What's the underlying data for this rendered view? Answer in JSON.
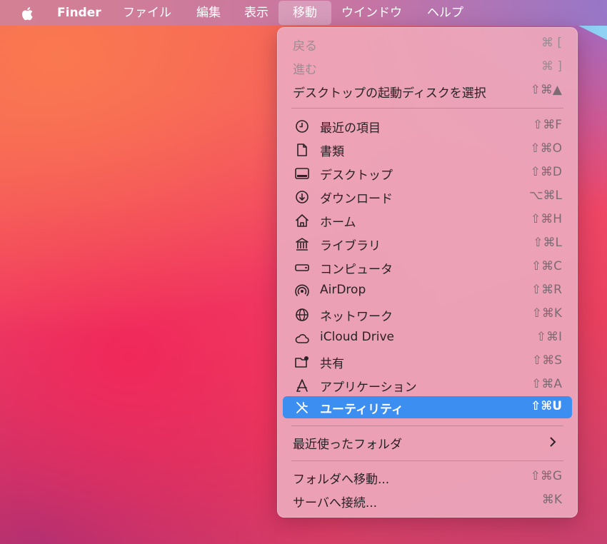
{
  "menubar": {
    "app": "Finder",
    "items": [
      "ファイル",
      "編集",
      "表示",
      "移動",
      "ウインドウ",
      "ヘルプ"
    ]
  },
  "go_menu": {
    "back": {
      "label": "戻る",
      "shortcut": "⌘ ["
    },
    "forward": {
      "label": "進む",
      "shortcut": "⌘ ]"
    },
    "startup_disk": {
      "label": "デスクトップの起動ディスクを選択",
      "shortcut": "⇧⌘▲"
    },
    "places": [
      {
        "label": "最近の項目",
        "shortcut": "⇧⌘F",
        "icon": "clock-icon"
      },
      {
        "label": "書類",
        "shortcut": "⇧⌘O",
        "icon": "document-icon"
      },
      {
        "label": "デスクトップ",
        "shortcut": "⇧⌘D",
        "icon": "desktop-icon"
      },
      {
        "label": "ダウンロード",
        "shortcut": "⌥⌘L",
        "icon": "download-icon"
      },
      {
        "label": "ホーム",
        "shortcut": "⇧⌘H",
        "icon": "home-icon"
      },
      {
        "label": "ライブラリ",
        "shortcut": "⇧⌘L",
        "icon": "library-icon"
      },
      {
        "label": "コンピュータ",
        "shortcut": "⇧⌘C",
        "icon": "computer-icon"
      },
      {
        "label": "AirDrop",
        "shortcut": "⇧⌘R",
        "icon": "airdrop-icon"
      },
      {
        "label": "ネットワーク",
        "shortcut": "⇧⌘K",
        "icon": "network-icon"
      },
      {
        "label": "iCloud Drive",
        "shortcut": "⇧⌘I",
        "icon": "icloud-icon"
      },
      {
        "label": "共有",
        "shortcut": "⇧⌘S",
        "icon": "shared-folder-icon"
      },
      {
        "label": "アプリケーション",
        "shortcut": "⇧⌘A",
        "icon": "applications-icon"
      },
      {
        "label": "ユーティリティ",
        "shortcut": "⇧⌘U",
        "icon": "utilities-icon"
      }
    ],
    "recent_folders": {
      "label": "最近使ったフォルダ"
    },
    "go_to_folder": {
      "label": "フォルダへ移動...",
      "shortcut": "⇧⌘G"
    },
    "connect_server": {
      "label": "サーバへ接続...",
      "shortcut": "⌘K"
    }
  },
  "colors": {
    "selection": "#3d8ef1"
  }
}
